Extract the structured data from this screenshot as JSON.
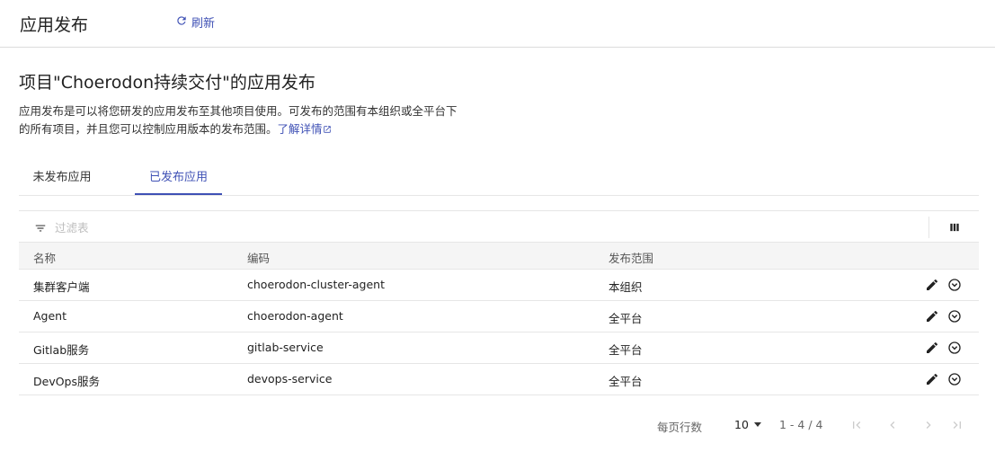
{
  "header": {
    "title": "应用发布",
    "refresh_label": "刷新"
  },
  "page": {
    "title": "项目\"Choerodon持续交付\"的应用发布",
    "description_line1": "应用发布是可以将您研发的应用发布至其他项目使用。可发布的范围有本组织或全平台下",
    "description_line2": "的所有项目，并且您可以控制应用版本的发布范围。",
    "learn_more": "了解详情"
  },
  "tabs": [
    {
      "label": "未发布应用"
    },
    {
      "label": "已发布应用"
    }
  ],
  "filter": {
    "placeholder": "过滤表"
  },
  "table": {
    "columns": [
      "名称",
      "编码",
      "发布范围"
    ],
    "rows": [
      {
        "name": "集群客户端",
        "code": "choerodon-cluster-agent",
        "scope": "本组织"
      },
      {
        "name": "Agent",
        "code": "choerodon-agent",
        "scope": "全平台"
      },
      {
        "name": "Gitlab服务",
        "code": "gitlab-service",
        "scope": "全平台"
      },
      {
        "name": "DevOps服务",
        "code": "devops-service",
        "scope": "全平台"
      }
    ]
  },
  "pagination": {
    "rows_per_page_label": "每页行数",
    "page_size": "10",
    "range": "1 - 4 / 4"
  },
  "colors": {
    "accent": "#3f51b5",
    "border": "#e6e6e6",
    "header_bg": "#f5f5f5"
  }
}
